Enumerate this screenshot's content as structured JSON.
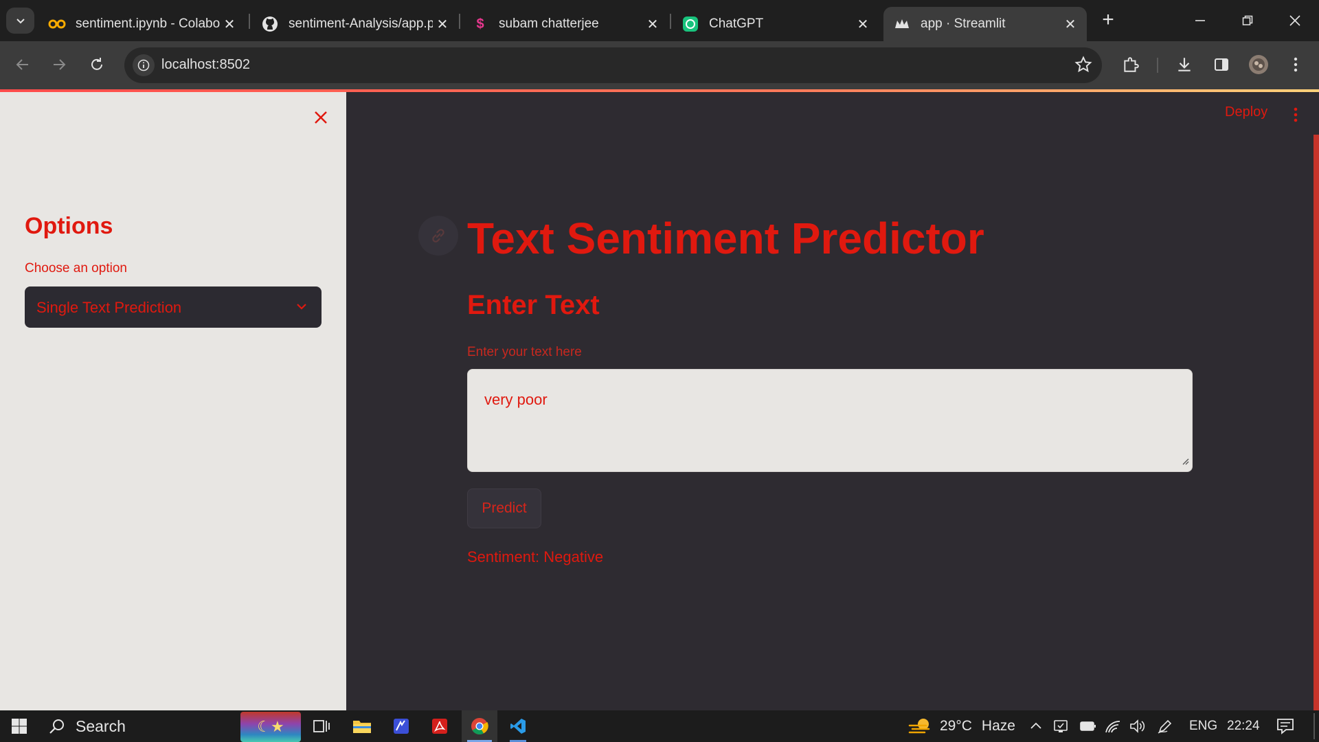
{
  "browser": {
    "tabs": [
      {
        "title": "sentiment.ipynb - Colabo",
        "icon": "colab-icon"
      },
      {
        "title": "sentiment-Analysis/app.p",
        "icon": "github-icon"
      },
      {
        "title": "subam chatterjee",
        "icon": "slack-s-icon"
      },
      {
        "title": "ChatGPT",
        "icon": "chatgpt-icon"
      },
      {
        "title": "app · Streamlit",
        "icon": "streamlit-icon",
        "active": true
      }
    ],
    "url": "localhost:8502"
  },
  "sidebar": {
    "heading": "Options",
    "select_label": "Choose an option",
    "select_value": "Single Text Prediction"
  },
  "main": {
    "deploy_label": "Deploy",
    "title": "Text Sentiment Predictor",
    "subheading": "Enter Text",
    "textarea_label": "Enter your text here",
    "textarea_value": "very poor",
    "predict_label": "Predict",
    "result": "Sentiment: Negative"
  },
  "taskbar": {
    "search_label": "Search",
    "weather": "29°C",
    "weather_desc": "Haze",
    "language": "ENG",
    "time": "22:24"
  },
  "colors": {
    "accent": "#e0190f",
    "main_bg": "#2e2b31",
    "sidebar_bg": "#e8e6e3"
  }
}
